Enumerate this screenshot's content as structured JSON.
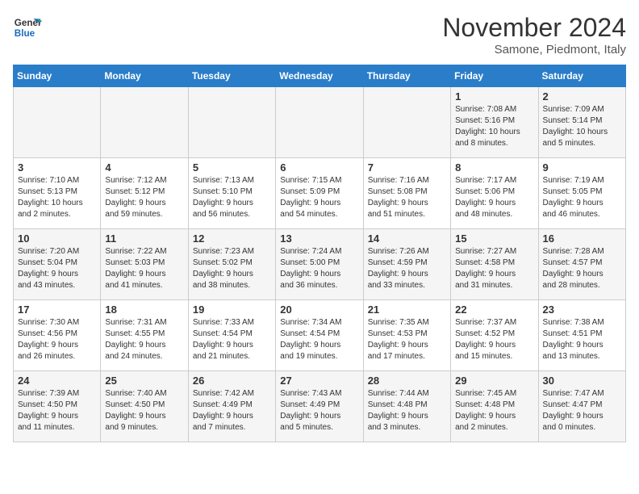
{
  "header": {
    "logo_line1": "General",
    "logo_line2": "Blue",
    "month": "November 2024",
    "location": "Samone, Piedmont, Italy"
  },
  "weekdays": [
    "Sunday",
    "Monday",
    "Tuesday",
    "Wednesday",
    "Thursday",
    "Friday",
    "Saturday"
  ],
  "weeks": [
    [
      {
        "day": "",
        "info": ""
      },
      {
        "day": "",
        "info": ""
      },
      {
        "day": "",
        "info": ""
      },
      {
        "day": "",
        "info": ""
      },
      {
        "day": "",
        "info": ""
      },
      {
        "day": "1",
        "info": "Sunrise: 7:08 AM\nSunset: 5:16 PM\nDaylight: 10 hours\nand 8 minutes."
      },
      {
        "day": "2",
        "info": "Sunrise: 7:09 AM\nSunset: 5:14 PM\nDaylight: 10 hours\nand 5 minutes."
      }
    ],
    [
      {
        "day": "3",
        "info": "Sunrise: 7:10 AM\nSunset: 5:13 PM\nDaylight: 10 hours\nand 2 minutes."
      },
      {
        "day": "4",
        "info": "Sunrise: 7:12 AM\nSunset: 5:12 PM\nDaylight: 9 hours\nand 59 minutes."
      },
      {
        "day": "5",
        "info": "Sunrise: 7:13 AM\nSunset: 5:10 PM\nDaylight: 9 hours\nand 56 minutes."
      },
      {
        "day": "6",
        "info": "Sunrise: 7:15 AM\nSunset: 5:09 PM\nDaylight: 9 hours\nand 54 minutes."
      },
      {
        "day": "7",
        "info": "Sunrise: 7:16 AM\nSunset: 5:08 PM\nDaylight: 9 hours\nand 51 minutes."
      },
      {
        "day": "8",
        "info": "Sunrise: 7:17 AM\nSunset: 5:06 PM\nDaylight: 9 hours\nand 48 minutes."
      },
      {
        "day": "9",
        "info": "Sunrise: 7:19 AM\nSunset: 5:05 PM\nDaylight: 9 hours\nand 46 minutes."
      }
    ],
    [
      {
        "day": "10",
        "info": "Sunrise: 7:20 AM\nSunset: 5:04 PM\nDaylight: 9 hours\nand 43 minutes."
      },
      {
        "day": "11",
        "info": "Sunrise: 7:22 AM\nSunset: 5:03 PM\nDaylight: 9 hours\nand 41 minutes."
      },
      {
        "day": "12",
        "info": "Sunrise: 7:23 AM\nSunset: 5:02 PM\nDaylight: 9 hours\nand 38 minutes."
      },
      {
        "day": "13",
        "info": "Sunrise: 7:24 AM\nSunset: 5:00 PM\nDaylight: 9 hours\nand 36 minutes."
      },
      {
        "day": "14",
        "info": "Sunrise: 7:26 AM\nSunset: 4:59 PM\nDaylight: 9 hours\nand 33 minutes."
      },
      {
        "day": "15",
        "info": "Sunrise: 7:27 AM\nSunset: 4:58 PM\nDaylight: 9 hours\nand 31 minutes."
      },
      {
        "day": "16",
        "info": "Sunrise: 7:28 AM\nSunset: 4:57 PM\nDaylight: 9 hours\nand 28 minutes."
      }
    ],
    [
      {
        "day": "17",
        "info": "Sunrise: 7:30 AM\nSunset: 4:56 PM\nDaylight: 9 hours\nand 26 minutes."
      },
      {
        "day": "18",
        "info": "Sunrise: 7:31 AM\nSunset: 4:55 PM\nDaylight: 9 hours\nand 24 minutes."
      },
      {
        "day": "19",
        "info": "Sunrise: 7:33 AM\nSunset: 4:54 PM\nDaylight: 9 hours\nand 21 minutes."
      },
      {
        "day": "20",
        "info": "Sunrise: 7:34 AM\nSunset: 4:54 PM\nDaylight: 9 hours\nand 19 minutes."
      },
      {
        "day": "21",
        "info": "Sunrise: 7:35 AM\nSunset: 4:53 PM\nDaylight: 9 hours\nand 17 minutes."
      },
      {
        "day": "22",
        "info": "Sunrise: 7:37 AM\nSunset: 4:52 PM\nDaylight: 9 hours\nand 15 minutes."
      },
      {
        "day": "23",
        "info": "Sunrise: 7:38 AM\nSunset: 4:51 PM\nDaylight: 9 hours\nand 13 minutes."
      }
    ],
    [
      {
        "day": "24",
        "info": "Sunrise: 7:39 AM\nSunset: 4:50 PM\nDaylight: 9 hours\nand 11 minutes."
      },
      {
        "day": "25",
        "info": "Sunrise: 7:40 AM\nSunset: 4:50 PM\nDaylight: 9 hours\nand 9 minutes."
      },
      {
        "day": "26",
        "info": "Sunrise: 7:42 AM\nSunset: 4:49 PM\nDaylight: 9 hours\nand 7 minutes."
      },
      {
        "day": "27",
        "info": "Sunrise: 7:43 AM\nSunset: 4:49 PM\nDaylight: 9 hours\nand 5 minutes."
      },
      {
        "day": "28",
        "info": "Sunrise: 7:44 AM\nSunset: 4:48 PM\nDaylight: 9 hours\nand 3 minutes."
      },
      {
        "day": "29",
        "info": "Sunrise: 7:45 AM\nSunset: 4:48 PM\nDaylight: 9 hours\nand 2 minutes."
      },
      {
        "day": "30",
        "info": "Sunrise: 7:47 AM\nSunset: 4:47 PM\nDaylight: 9 hours\nand 0 minutes."
      }
    ]
  ]
}
